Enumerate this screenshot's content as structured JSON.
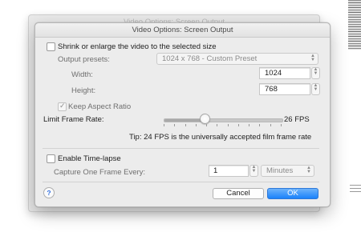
{
  "window": {
    "background_title": "Video Options: Screen Output",
    "title": "Video Options: Screen Output"
  },
  "resize": {
    "checkbox_label": "Shrink or enlarge the video to the selected size",
    "checked": false,
    "presets_label": "Output presets:",
    "preset_value": "1024 x 768 - Custom Preset",
    "width_label": "Width:",
    "width_value": "1024",
    "height_label": "Height:",
    "height_value": "768",
    "keep_aspect_label": "Keep Aspect Ratio",
    "keep_aspect_checked": true
  },
  "frame_rate": {
    "label": "Limit Frame Rate:",
    "value_text": "26 FPS",
    "slider_fraction": 0.34,
    "tick_count": 12,
    "tip": "Tip: 24 FPS is the universally accepted film frame rate"
  },
  "timelapse": {
    "checkbox_label": "Enable Time-lapse",
    "checked": false,
    "capture_label": "Capture One Frame Every:",
    "capture_value": "1",
    "unit_value": "Minutes"
  },
  "buttons": {
    "help": "?",
    "cancel": "Cancel",
    "ok": "OK"
  },
  "icons": {
    "help": "question-mark-icon",
    "stepper": "stepper-arrows-icon",
    "popup": "popup-arrows-icon",
    "check": "checkmark-icon"
  },
  "colors": {
    "accent": "#1a82fb",
    "dialog_bg": "#ececec"
  }
}
